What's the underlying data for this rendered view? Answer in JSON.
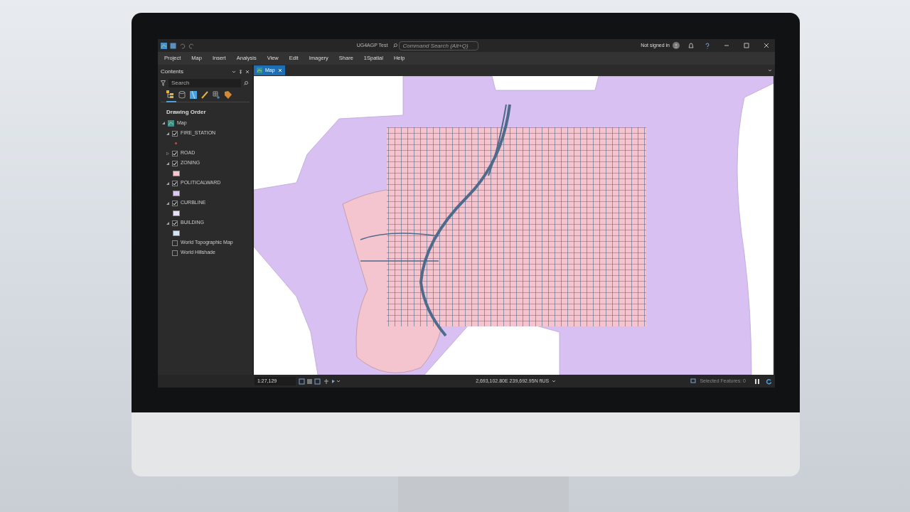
{
  "window": {
    "title": "UG4AGP Test",
    "search": {
      "placeholder": "Command Search (Alt+Q)"
    },
    "account": "Not signed in"
  },
  "menu": [
    {
      "label": "Project",
      "selected": false
    },
    {
      "label": "Map",
      "selected": false
    },
    {
      "label": "Insert",
      "selected": false
    },
    {
      "label": "Analysis",
      "selected": false
    },
    {
      "label": "View",
      "selected": false
    },
    {
      "label": "Edit",
      "selected": false
    },
    {
      "label": "Imagery",
      "selected": false
    },
    {
      "label": "Share",
      "selected": false
    },
    {
      "label": "1Spatial",
      "selected": false
    },
    {
      "label": "Help",
      "selected": false
    }
  ],
  "contents": {
    "title": "Contents",
    "search": {
      "placeholder": "Search"
    },
    "heading": "Drawing Order",
    "map": "Map",
    "layers": [
      {
        "kind": "layer",
        "name": "FIRE_STATION",
        "checked": true,
        "expanded": true,
        "color": "#c0504d"
      },
      {
        "kind": "layer",
        "name": "ROAD",
        "checked": true,
        "expanded": false
      },
      {
        "kind": "layer",
        "name": "ZONING",
        "checked": true,
        "expanded": true,
        "color": "#f4c6d0"
      },
      {
        "kind": "layer",
        "name": "POLITICALWARD",
        "checked": true,
        "expanded": true,
        "color": "#dcc6f4"
      },
      {
        "kind": "layer",
        "name": "CURBLINE",
        "checked": true,
        "expanded": true,
        "color": "#e8e0f4"
      },
      {
        "kind": "layer",
        "name": "BUILDING",
        "checked": true,
        "expanded": true,
        "color": "#d4e4f4"
      },
      {
        "kind": "basemap",
        "name": "World Topographic Map",
        "checked": false
      },
      {
        "kind": "basemap",
        "name": "World Hillshade",
        "checked": false
      }
    ]
  },
  "map_tab": {
    "label": "Map",
    "selected": true
  },
  "status_bar": {
    "scale": "1:27,129",
    "coordinates": "2,693,102.80E 239,692.95N ftUS",
    "selected_features": "Selected Features: 0"
  }
}
